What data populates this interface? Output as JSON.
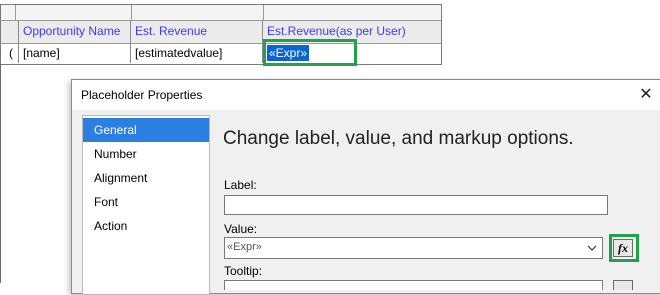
{
  "report": {
    "columns": [
      "Opportunity Name",
      "Est. Revenue",
      "Est.Revenue(as per User)"
    ],
    "row_marker": "(",
    "cells": [
      "[name]",
      "[estimatedvalue]",
      "«Expr»"
    ]
  },
  "dialog": {
    "title": "Placeholder Properties",
    "close_glyph": "✕",
    "nav": [
      "General",
      "Number",
      "Alignment",
      "Font",
      "Action"
    ],
    "active_nav": "General",
    "heading": "Change label, value, and markup options.",
    "label_field": {
      "label": "Label:",
      "value": ""
    },
    "value_field": {
      "label": "Value:",
      "value": "«Expr»"
    },
    "fx_button": "fx",
    "tooltip_label": "Tooltip:"
  },
  "colors": {
    "header_text": "#3a3aef",
    "selection": "#0a64d2",
    "highlight_box": "#1fa34a",
    "nav_active": "#2b7fe0"
  },
  "icons": [
    "close-icon",
    "chevron-down-icon",
    "function-icon"
  ]
}
